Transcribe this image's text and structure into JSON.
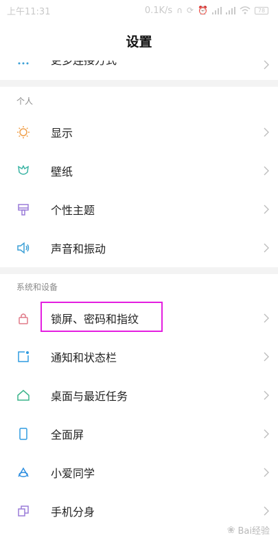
{
  "status_bar": {
    "time": "上午11:31",
    "net_speed": "0.1K/s",
    "battery": "78"
  },
  "header": {
    "title": "设置"
  },
  "partial_item": {
    "label": "更多连接方式",
    "icon": "more-dots-icon"
  },
  "sections": [
    {
      "header": "个人",
      "items": [
        {
          "label": "显示",
          "icon": "sun-icon",
          "color": "#f0a04b"
        },
        {
          "label": "壁纸",
          "icon": "wallpaper-tulip-icon",
          "color": "#3ab4a4"
        },
        {
          "label": "个性主题",
          "icon": "theme-brush-icon",
          "color": "#9a7bd8"
        },
        {
          "label": "声音和振动",
          "icon": "speaker-icon",
          "color": "#3a9fd6"
        }
      ]
    },
    {
      "header": "系统和设备",
      "items": [
        {
          "label": "锁屏、密码和指纹",
          "icon": "lock-icon",
          "color": "#e07a88"
        },
        {
          "label": "通知和状态栏",
          "icon": "notification-icon",
          "color": "#2f9be0"
        },
        {
          "label": "桌面与最近任务",
          "icon": "home-icon",
          "color": "#3ab48a"
        },
        {
          "label": "全面屏",
          "icon": "fullscreen-phone-icon",
          "color": "#2f9be0"
        },
        {
          "label": "小爱同学",
          "icon": "xiaoai-icon",
          "color": "#2f8fe0"
        },
        {
          "label": "手机分身",
          "icon": "second-space-icon",
          "color": "#9a7bd8"
        }
      ]
    }
  ],
  "watermark": {
    "text": "Bai经验"
  }
}
